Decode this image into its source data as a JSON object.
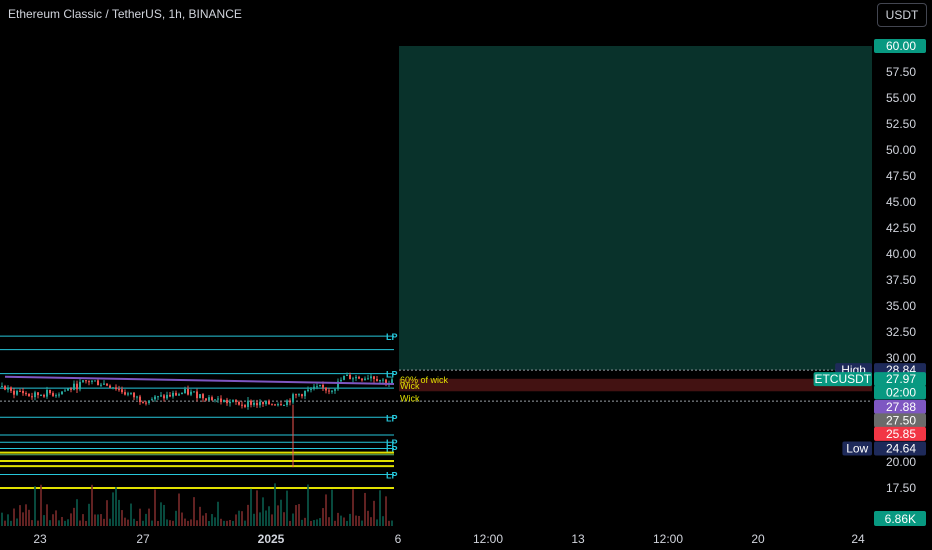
{
  "header": {
    "title": "Ethereum Classic / TetherUS, 1h, BINANCE",
    "currency_label": "USDT"
  },
  "chart_data": {
    "type": "line",
    "symbol": "ETCUSDT",
    "ylim": [
      15.0,
      60.0
    ],
    "y_ticks": [
      "17.50",
      "20.00",
      "22.50",
      "25.00",
      "27.50",
      "30.00",
      "32.50",
      "35.00",
      "37.50",
      "40.00",
      "42.50",
      "45.00",
      "47.50",
      "50.00",
      "52.50",
      "55.00",
      "57.50"
    ],
    "x_ticks": [
      {
        "label": "23",
        "bold": false
      },
      {
        "label": "27",
        "bold": false
      },
      {
        "label": "2025",
        "bold": true
      },
      {
        "label": "6",
        "bold": false
      },
      {
        "label": "12:00",
        "bold": false
      },
      {
        "label": "13",
        "bold": false
      },
      {
        "label": "12:00",
        "bold": false
      },
      {
        "label": "20",
        "bold": false
      },
      {
        "label": "24",
        "bold": false
      }
    ],
    "price_series": {
      "anchors": [
        [
          0,
          27.3
        ],
        [
          10,
          26.7
        ],
        [
          20,
          26.8
        ],
        [
          30,
          26.3
        ],
        [
          42,
          26.6
        ],
        [
          55,
          26.6
        ],
        [
          68,
          27.0
        ],
        [
          80,
          27.5
        ],
        [
          88,
          27.8
        ],
        [
          100,
          27.6
        ],
        [
          112,
          27.3
        ],
        [
          125,
          26.6
        ],
        [
          140,
          26.0
        ],
        [
          155,
          26.1
        ],
        [
          170,
          26.4
        ],
        [
          185,
          26.7
        ],
        [
          200,
          26.4
        ],
        [
          215,
          26.0
        ],
        [
          230,
          25.7
        ],
        [
          240,
          25.6
        ],
        [
          250,
          25.7
        ],
        [
          262,
          25.5
        ],
        [
          275,
          25.7
        ],
        [
          285,
          25.8
        ],
        [
          292,
          26.2
        ],
        [
          300,
          26.6
        ],
        [
          310,
          26.9
        ],
        [
          320,
          27.1
        ],
        [
          328,
          27.0
        ],
        [
          335,
          27.3
        ],
        [
          342,
          28.1
        ],
        [
          350,
          28.2
        ],
        [
          360,
          28.1
        ],
        [
          370,
          28.3
        ],
        [
          380,
          27.9
        ],
        [
          388,
          27.6
        ],
        [
          394,
          27.9
        ]
      ]
    },
    "trendline": {
      "from": [
        5,
        28.2
      ],
      "to": [
        394,
        27.5
      ],
      "color": "#7e57c2"
    },
    "target_zone": {
      "top": 60.0,
      "bottom": 28.84,
      "start_x": 399
    },
    "stop_zone": {
      "top": 28.0,
      "bottom": 26.8,
      "start_x": 399
    },
    "horizontal_levels": [
      {
        "price": 32.1,
        "color": "#26c6da",
        "label": "LP"
      },
      {
        "price": 30.8,
        "color": "#26c6da",
        "label": ""
      },
      {
        "price": 28.5,
        "color": "#26c6da",
        "label": "LP"
      },
      {
        "price": 27.1,
        "color": "#26c6da",
        "label": ""
      },
      {
        "price": 24.3,
        "color": "#26c6da",
        "label": "LP"
      },
      {
        "price": 22.6,
        "color": "#26c6da",
        "label": ""
      },
      {
        "price": 21.9,
        "color": "#26c6da",
        "label": "LP"
      },
      {
        "price": 21.3,
        "color": "#26c6da",
        "label": "LP"
      },
      {
        "price": 20.9,
        "color": "#e0e000",
        "label": ""
      },
      {
        "price": 20.7,
        "color": "#66bb6a",
        "label": ""
      },
      {
        "price": 20.1,
        "color": "#e0e000",
        "label": ""
      },
      {
        "price": 19.6,
        "color": "#e0e000",
        "label": ""
      },
      {
        "price": 18.8,
        "color": "#26c6da",
        "label": "LP"
      },
      {
        "price": 17.5,
        "color": "#e0e000",
        "label": ""
      }
    ],
    "annotations": [
      {
        "text": "60% of wick",
        "price": 28.0,
        "color": "#e0e000"
      },
      {
        "text": "Wick",
        "price": 27.4,
        "color": "#e0e000"
      },
      {
        "text": "Wick",
        "price": 26.2,
        "color": "#e0e000"
      }
    ],
    "price_tags": [
      {
        "text": "60.00",
        "price": 60.0,
        "bg": "#089981",
        "label": ""
      },
      {
        "text": "28.84",
        "price": 28.84,
        "bg": "#1e2a5a",
        "label": "High"
      },
      {
        "text": "27.97",
        "price": 27.97,
        "bg": "#089981",
        "label": "ETCUSDT"
      },
      {
        "text": "02:00",
        "price": 26.7,
        "bg": "#089981",
        "label": ""
      },
      {
        "text": "27.88",
        "price": 25.3,
        "bg": "#7e57c2",
        "label": ""
      },
      {
        "text": "27.50",
        "price": 24.0,
        "bg": "#6b6b6b",
        "label": ""
      },
      {
        "text": "25.85",
        "price": 22.7,
        "bg": "#f23645",
        "label": ""
      },
      {
        "text": "24.64",
        "price": 21.3,
        "bg": "#1e2a5a",
        "label": "Low"
      }
    ],
    "volume_tag": {
      "text": "6.86K",
      "bg": "#089981"
    }
  }
}
